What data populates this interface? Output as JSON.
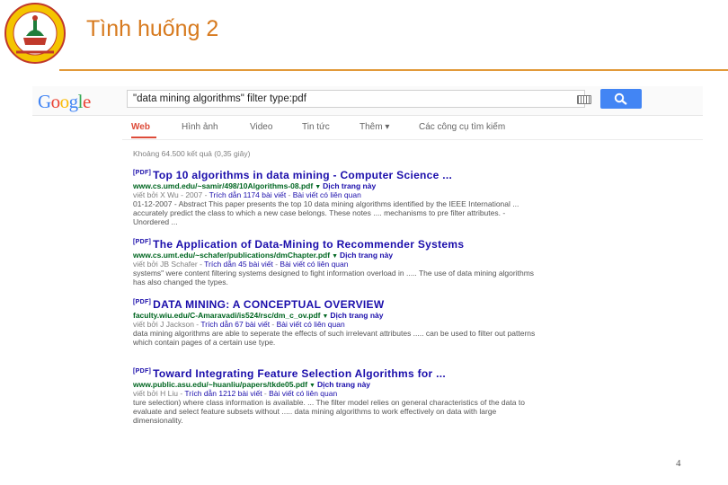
{
  "slide": {
    "title": "Tình huống 2",
    "page_number": "4",
    "accent_color": "#e29a3a",
    "logo_icon": "university-seal-icon"
  },
  "search": {
    "logo_text": "Google",
    "query": "\"data mining algorithms\" filter type:pdf",
    "keyboard_icon": "keyboard-icon",
    "search_icon": "search-icon"
  },
  "tabs": [
    {
      "label": "Web",
      "active": true
    },
    {
      "label": "Hình ảnh",
      "active": false
    },
    {
      "label": "Video",
      "active": false
    },
    {
      "label": "Tin tức",
      "active": false
    },
    {
      "label": "Thêm ▾",
      "active": false
    },
    {
      "label": "Các công cụ tìm kiếm",
      "active": false
    }
  ],
  "stats": "Khoảng 64.500 kết quả (0,35 giây)",
  "results": [
    {
      "tag": "[PDF]",
      "title": "Top 10 algorithms in data mining - Computer Science ...",
      "url": "www.cs.umd.edu/~samir/498/10Algorithms-08.pdf",
      "cached": "Dịch trang này",
      "meta_author": "viết bởi X Wu - 2007 -",
      "meta_cited": "Trích dẫn 1174 bài viết",
      "meta_related": "Bài viết có liên quan",
      "snippet": "01-12-2007 - Abstract This paper presents the top 10 data mining algorithms identified by the IEEE International ... accurately predict the class to which a new case belongs. These notes .... mechanisms to pre filter attributes. - Unordered ..."
    },
    {
      "tag": "[PDF]",
      "title": "The Application of Data-Mining to Recommender Systems",
      "url": "www.cs.umt.edu/~schafer/publications/dmChapter.pdf",
      "cached": "Dịch trang này",
      "meta_author": "viết bởi JB Schafer -",
      "meta_cited": "Trích dẫn 45 bài viết",
      "meta_related": "Bài viết có liên quan",
      "snippet": "systems\" were content filtering systems designed to fight information overload in ..... The use of data mining algorithms has also changed the types."
    },
    {
      "tag": "[PDF]",
      "title": "DATA MINING: A CONCEPTUAL OVERVIEW",
      "url": "faculty.wiu.edu/C-Amaravadi/is524/rsc/dm_c_ov.pdf",
      "cached": "Dịch trang này",
      "meta_author": "viết bởi J Jackson -",
      "meta_cited": "Trích dẫn 67 bài viết",
      "meta_related": "Bài viết có liên quan",
      "snippet": "data mining algorithms are able to seperate the effects of such irrelevant attributes ..... can be used to filter out patterns which contain pages of a certain use type."
    },
    {
      "tag": "[PDF]",
      "title": "Toward Integrating Feature Selection Algorithms for ...",
      "url": "www.public.asu.edu/~huanliu/papers/tkde05.pdf",
      "cached": "Dịch trang này",
      "meta_author": "viết bởi H Liu -",
      "meta_cited": "Trích dẫn 1212 bài viết",
      "meta_related": "Bài viết có liên quan",
      "snippet": "ture selection) where class information is available. ... The filter model relies on general characteristics of the data to evaluate and select feature subsets without ..... data mining algorithms to work effectively on data with large dimensionality."
    }
  ]
}
